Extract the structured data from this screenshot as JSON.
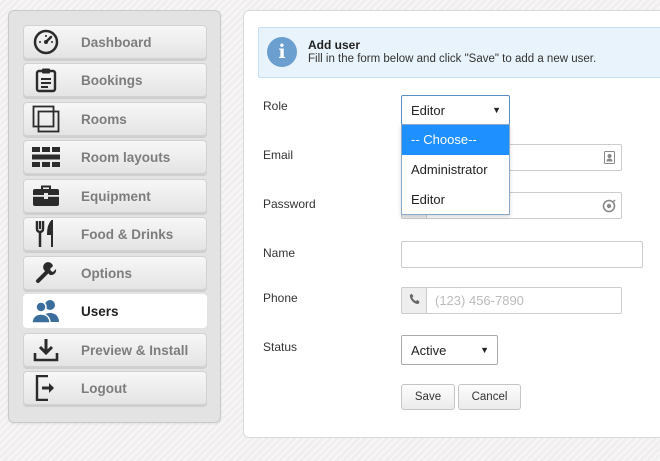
{
  "sidebar": {
    "items": [
      {
        "label": "Dashboard",
        "icon": "dashboard-icon"
      },
      {
        "label": "Bookings",
        "icon": "clipboard-icon"
      },
      {
        "label": "Rooms",
        "icon": "rooms-icon"
      },
      {
        "label": "Room layouts",
        "icon": "room-layouts-icon"
      },
      {
        "label": "Equipment",
        "icon": "toolbox-icon"
      },
      {
        "label": "Food & Drinks",
        "icon": "fork-knife-icon"
      },
      {
        "label": "Options",
        "icon": "wrench-icon"
      },
      {
        "label": "Users",
        "icon": "users-icon"
      },
      {
        "label": "Preview & Install",
        "icon": "download-icon"
      },
      {
        "label": "Logout",
        "icon": "logout-icon"
      }
    ],
    "active_item": "Users"
  },
  "info": {
    "title": "Add user",
    "text": "Fill in the form below and click \"Save\" to add a new user."
  },
  "form": {
    "role": {
      "label": "Role",
      "value": "Editor",
      "options": [
        "-- Choose--",
        "Administrator",
        "Editor"
      ],
      "highlighted": "-- Choose--"
    },
    "email": {
      "label": "Email",
      "value": ""
    },
    "password": {
      "label": "Password",
      "value": ""
    },
    "name": {
      "label": "Name",
      "value": ""
    },
    "phone": {
      "label": "Phone",
      "placeholder": "(123) 456-7890"
    },
    "status": {
      "label": "Status",
      "value": "Active"
    },
    "save_label": "Save",
    "cancel_label": "Cancel"
  },
  "colors": {
    "accent": "#1e90ff",
    "info_bg": "#e9f3fb",
    "active_icon": "#3b6e9c"
  }
}
